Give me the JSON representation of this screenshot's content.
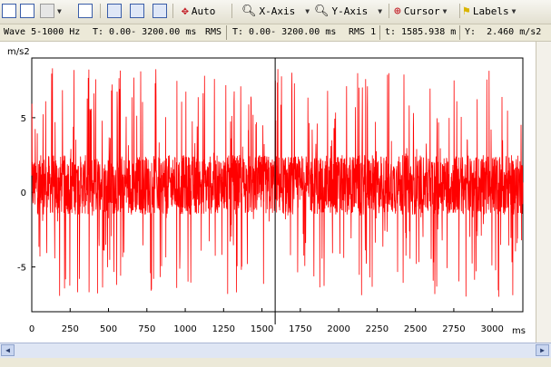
{
  "toolbar": {
    "auto_label": "Auto",
    "xaxis_label": "X-Axis",
    "yaxis_label": "Y-Axis",
    "cursor_label": "Cursor",
    "labels_label": "Labels"
  },
  "info": {
    "wave": "Wave 5-1000 Hz",
    "t_range": "T: 0.00- 3200.00 ms",
    "rms_label": "RMS",
    "t_range2": "T: 0.00- 3200.00 ms",
    "rms1": "RMS 1",
    "t_cursor": "t: 1585.938 m",
    "y_cursor": "Y:  2.460 m/s2"
  },
  "chart_data": {
    "type": "line",
    "ylabel": "m/s2",
    "xlabel": "ms",
    "xlim": [
      0,
      3200
    ],
    "ylim": [
      -8,
      9
    ],
    "x_ticks": [
      0,
      250,
      500,
      750,
      1000,
      1250,
      1500,
      1750,
      2000,
      2250,
      2500,
      2750,
      3000
    ],
    "y_ticks": [
      5,
      0,
      -5
    ],
    "cursor_x": 1585.938,
    "series": [
      {
        "color": "#ff0000",
        "signal": "noise",
        "baseline": 0.5,
        "core_amplitude": 2.0,
        "peak_range": [
          -7,
          8.5
        ]
      }
    ],
    "grid": false
  }
}
